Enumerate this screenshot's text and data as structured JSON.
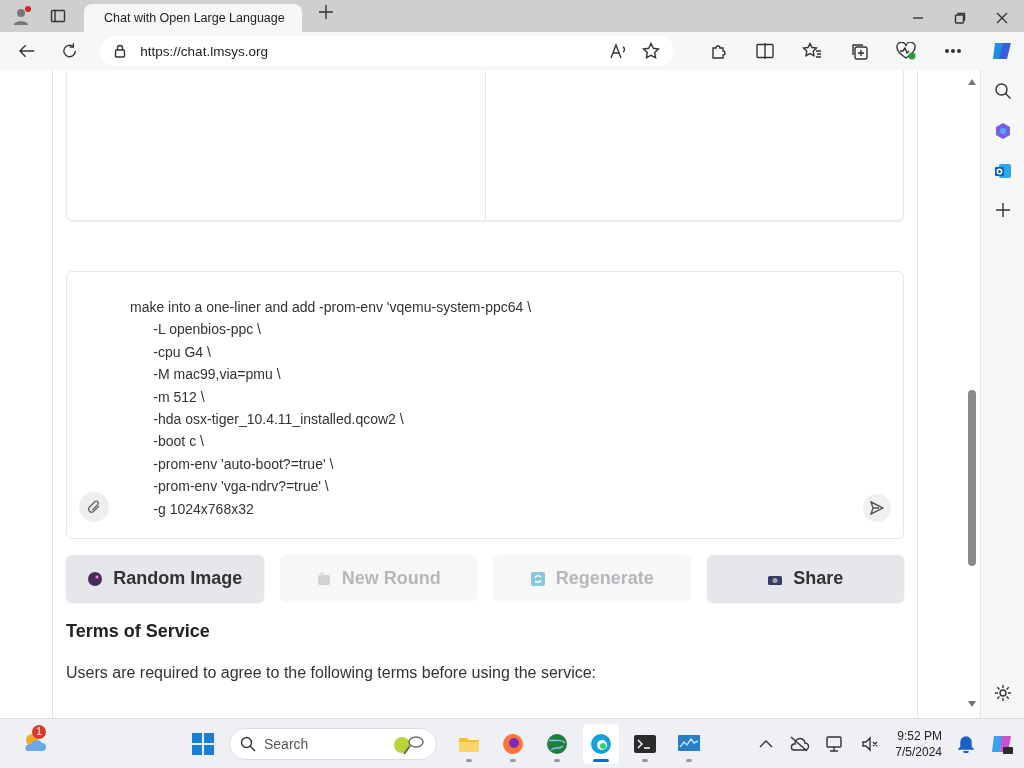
{
  "browser": {
    "tab": {
      "title": "Chat with Open Large Language",
      "selected": true
    },
    "url": "https://chat.lmsys.org"
  },
  "chat": {
    "message": {
      "value": "make into a one-liner and add -prom-env 'vqemu-system-ppc64 \\\n      -L openbios-ppc \\\n      -cpu G4 \\\n      -M mac99,via=pmu \\\n      -m 512 \\\n      -hda osx-tiger_10.4.11_installed.qcow2 \\\n      -boot c \\\n      -prom-env 'auto-boot?=true' \\\n      -prom-env 'vga-ndrv?=true' \\\n      -g 1024x768x32"
    },
    "buttons": [
      {
        "label": "Random Image",
        "kind": "random",
        "disabled": false
      },
      {
        "label": "New Round",
        "kind": "new",
        "disabled": true
      },
      {
        "label": "Regenerate",
        "kind": "regen",
        "disabled": true
      },
      {
        "label": "Share",
        "kind": "share",
        "disabled": false
      }
    ]
  },
  "terms": {
    "heading": "Terms of Service",
    "intro": "Users are required to agree to the following terms before using the service:"
  },
  "taskbar": {
    "weather_badge": "1",
    "search": {
      "placeholder": "Search"
    },
    "apps": [
      {
        "kind": "files",
        "selected": false
      },
      {
        "kind": "firefox",
        "selected": false
      },
      {
        "kind": "globe",
        "selected": false
      },
      {
        "kind": "edge",
        "selected": true
      },
      {
        "kind": "terminal",
        "selected": false
      },
      {
        "kind": "monitor",
        "selected": false
      }
    ],
    "time": "9:52 PM",
    "date": "7/5/2024"
  }
}
